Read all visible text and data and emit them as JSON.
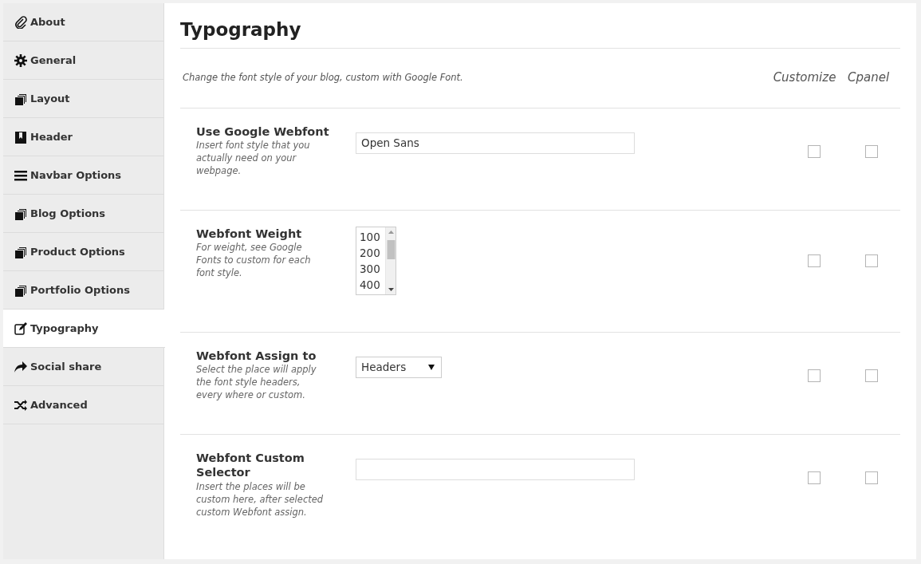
{
  "sidebar": {
    "items": [
      {
        "label": "About",
        "selected": false
      },
      {
        "label": "General",
        "selected": false
      },
      {
        "label": "Layout",
        "selected": false
      },
      {
        "label": "Header",
        "selected": false
      },
      {
        "label": "Navbar Options",
        "selected": false
      },
      {
        "label": "Blog Options",
        "selected": false
      },
      {
        "label": "Product Options",
        "selected": false
      },
      {
        "label": "Portfolio Options",
        "selected": false
      },
      {
        "label": "Typography",
        "selected": true
      },
      {
        "label": "Social share",
        "selected": false
      },
      {
        "label": "Advanced",
        "selected": false
      }
    ]
  },
  "panel": {
    "title": "Typography",
    "intro": "Change the font style of your blog, custom with Google Font.",
    "column_headers": [
      "Customize",
      "Cpanel"
    ],
    "settings": [
      {
        "kind": "text",
        "label": "Use Google Webfont",
        "description": "Insert font style that you actually need on your webpage.",
        "value": "Open Sans",
        "customize_checked": false,
        "cpanel_checked": false
      },
      {
        "kind": "listbox",
        "label": "Webfont Weight",
        "description": "For weight, see Google Fonts to custom for each font style.",
        "options": [
          "100",
          "200",
          "300",
          "400"
        ],
        "customize_checked": false,
        "cpanel_checked": false
      },
      {
        "kind": "select",
        "label": "Webfont Assign to",
        "description": "Select the place will apply the font style headers, every where or custom.",
        "value": "Headers",
        "customize_checked": false,
        "cpanel_checked": false
      },
      {
        "kind": "text",
        "label": "Webfont Custom Selector",
        "description": "Insert the places will be custom here, after selected custom Webfont assign.",
        "customize_checked": false,
        "cpanel_checked": false
      }
    ]
  }
}
